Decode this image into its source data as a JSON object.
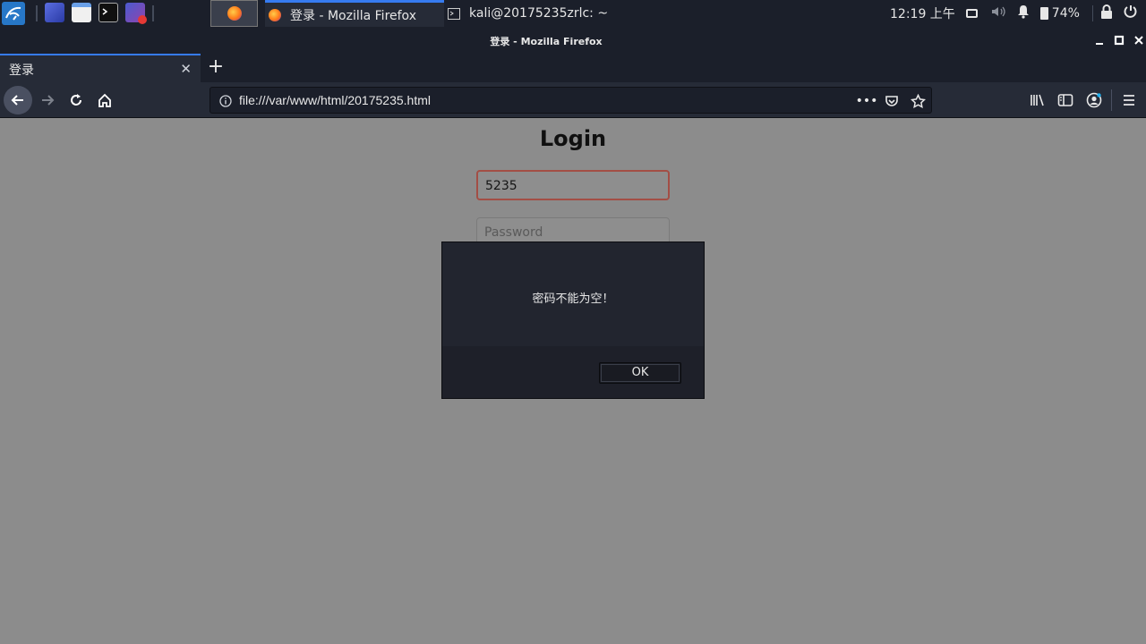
{
  "taskbar": {
    "tasks": [
      {
        "label": "登录 - Mozilla Firefox"
      },
      {
        "label": "kali@20175235zrlc: ~"
      }
    ],
    "clock": "12:19 上午",
    "battery": "74%"
  },
  "window": {
    "title": "登录 - Mozilla Firefox"
  },
  "browser": {
    "tab_label": "登录",
    "url": "file:///var/www/html/20175235.html"
  },
  "page": {
    "heading": "Login",
    "username_value": "5235",
    "password_placeholder": "Password"
  },
  "dialog": {
    "message": "密码不能为空！",
    "ok_label": "OK"
  },
  "colors": {
    "accent": "#367bf0",
    "panel_bg": "#1b1f2a",
    "page_bg": "#8c8c8c",
    "focused_input_border": "#a34e45"
  }
}
